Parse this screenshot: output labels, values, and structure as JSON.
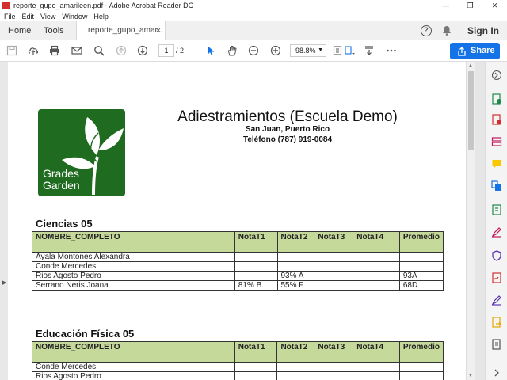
{
  "window": {
    "title": "reporte_gupo_amarileen.pdf - Adobe Acrobat Reader DC",
    "controls": [
      "—",
      "❐",
      "✕"
    ]
  },
  "menu": [
    "File",
    "Edit",
    "View",
    "Window",
    "Help"
  ],
  "tabs": {
    "home": "Home",
    "tools": "Tools",
    "document": "reporte_gupo_amar...",
    "close": "×"
  },
  "header": {
    "help": "?",
    "signin": "Sign In"
  },
  "toolbar": {
    "page_current": "1",
    "page_total": "/ 2",
    "zoom": "98.8%",
    "share": "Share"
  },
  "document": {
    "logo_line1": "Grades",
    "logo_line2": "Garden",
    "title": "Adiestramientos (Escuela Demo)",
    "subtitle1": "San Juan, Puerto Rico",
    "subtitle2": "Teléfono (787) 919-0084",
    "sections": [
      {
        "title": "Ciencias 05",
        "headers": [
          "NOMBRE_COMPLETO",
          "NotaT1",
          "NotaT2",
          "NotaT3",
          "NotaT4",
          "Promedio"
        ],
        "rows": [
          [
            "Ayala Montones Alexandra",
            "",
            "",
            "",
            "",
            ""
          ],
          [
            "Conde Mercedes",
            "",
            "",
            "",
            "",
            ""
          ],
          [
            "Rios Agosto Pedro",
            "",
            "93%  A",
            "",
            "",
            "93A"
          ],
          [
            "Serrano Neris Joana",
            "81%  B",
            "55%  F",
            "",
            "",
            "68D"
          ]
        ]
      },
      {
        "title": "Educación Física 05",
        "headers": [
          "NOMBRE_COMPLETO",
          "NotaT1",
          "NotaT2",
          "NotaT3",
          "NotaT4",
          "Promedio"
        ],
        "rows": [
          [
            "Conde Mercedes",
            "",
            "",
            "",
            "",
            ""
          ],
          [
            "Rios Agosto Pedro",
            "",
            "",
            "",
            "",
            ""
          ]
        ]
      }
    ]
  },
  "colors": {
    "accent": "#1473e6",
    "table_header": "#c5d99a",
    "logo_green": "#1f6b1f"
  }
}
